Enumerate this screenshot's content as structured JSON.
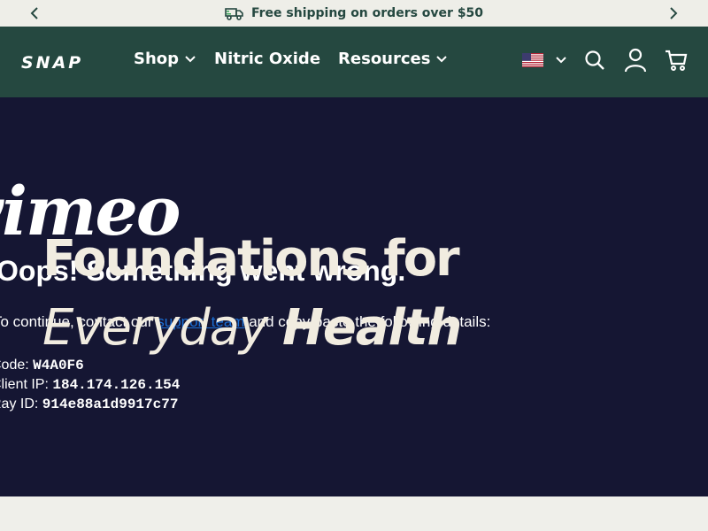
{
  "announcement": {
    "text": "Free shipping on orders over $50",
    "icon": "truck-icon"
  },
  "header": {
    "logo": "SNAP",
    "nav": [
      {
        "label": "Shop",
        "has_dropdown": true
      },
      {
        "label": "Nitric Oxide",
        "has_dropdown": false
      },
      {
        "label": "Resources",
        "has_dropdown": true
      }
    ],
    "icons": [
      "us-flag-icon",
      "chevron-down-icon",
      "search-icon",
      "account-icon",
      "cart-icon"
    ]
  },
  "hero": {
    "vimeo_logo": "vimeo",
    "error_title": "Oops! Something went wrong.",
    "error_desc_before": "To continue, contact our ",
    "error_desc_link": "support team",
    "error_desc_after": " and copy/paste the following details:",
    "details": [
      {
        "label": "Code: ",
        "value": "W4A0F6"
      },
      {
        "label": "Client IP: ",
        "value": "184.174.126.154"
      },
      {
        "label": "Ray ID: ",
        "value": "914e88a1d9917c77"
      }
    ],
    "headline_line1": "Foundations for",
    "headline_line2_light": "Everyday ",
    "headline_line2_bold": "Health"
  },
  "colors": {
    "header_bg": "#254840",
    "hero_bg": "#151633",
    "headline": "#f1ece0",
    "link": "#1a6fd6",
    "page_bg": "#efefea"
  }
}
